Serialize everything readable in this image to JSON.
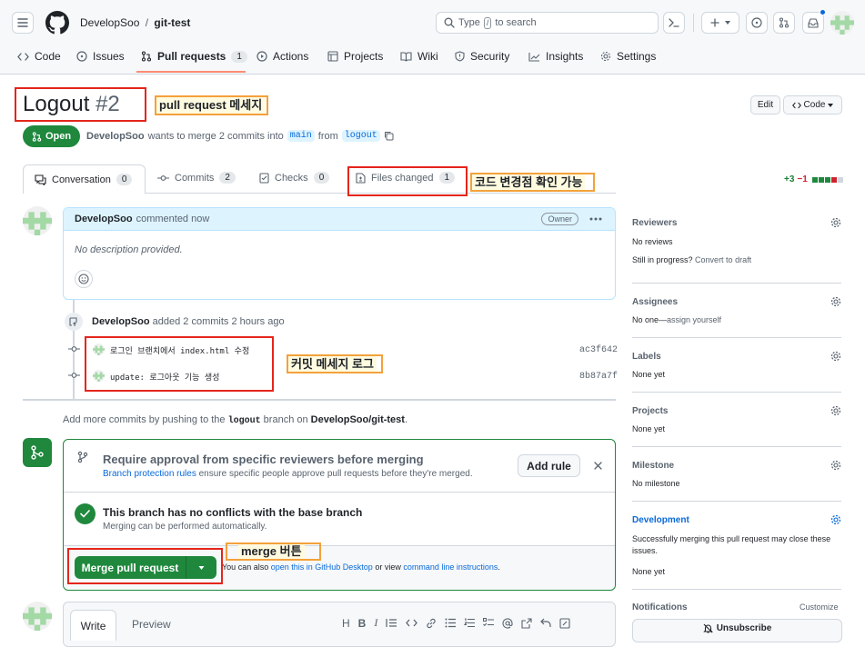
{
  "header": {
    "owner": "DevelopSoo",
    "sep": "/",
    "repo": "git-test",
    "search_prefix": "Type",
    "search_key": "/",
    "search_suffix": "to search"
  },
  "repo_nav": [
    {
      "label": "Code"
    },
    {
      "label": "Issues"
    },
    {
      "label": "Pull requests",
      "count": "1"
    },
    {
      "label": "Actions"
    },
    {
      "label": "Projects"
    },
    {
      "label": "Wiki"
    },
    {
      "label": "Security"
    },
    {
      "label": "Insights"
    },
    {
      "label": "Settings"
    }
  ],
  "pr": {
    "title": "Logout",
    "number": "#2",
    "state": "Open",
    "author": "DevelopSoo",
    "meta_text": "wants to merge 2 commits into",
    "base_branch": "main",
    "from_text": "from",
    "head_branch": "logout",
    "edit_label": "Edit",
    "code_label": "Code"
  },
  "pr_tabs": [
    {
      "label": "Conversation",
      "count": "0"
    },
    {
      "label": "Commits",
      "count": "2"
    },
    {
      "label": "Checks",
      "count": "0"
    },
    {
      "label": "Files changed",
      "count": "1"
    }
  ],
  "diffstat": {
    "add": "+3",
    "del": "−1"
  },
  "annotations": {
    "pr_message": "pull request 메세지",
    "files_changed": "코드 변경점 확인 가능",
    "commit_log": "커밋 메세지 로그",
    "merge_button": "merge 버튼"
  },
  "comment": {
    "author": "DevelopSoo",
    "action": "commented now",
    "role": "Owner",
    "body": "No description provided."
  },
  "commits_event": {
    "author": "DevelopSoo",
    "text": "added 2 commits 2 hours ago"
  },
  "commits": [
    {
      "message": "로그인 브랜치에서 index.html 수정",
      "sha": "ac3f642"
    },
    {
      "message": "update: 로그아웃 기능 생성",
      "sha": "8b87a7f"
    }
  ],
  "push_hint": {
    "prefix": "Add more commits by pushing to the",
    "branch": "logout",
    "middle": "branch on",
    "repo": "DevelopSoo/git-test",
    "suffix": "."
  },
  "merge_box": {
    "rule_title": "Require approval from specific reviewers before merging",
    "rule_link": "Branch protection rules",
    "rule_desc": "ensure specific people approve pull requests before they're merged.",
    "add_rule": "Add rule",
    "status_title": "This branch has no conflicts with the base branch",
    "status_desc": "Merging can be performed automatically.",
    "merge_label": "Merge pull request",
    "also_prefix": "You can also",
    "desktop_link": "open this in GitHub Desktop",
    "or_view": "or view",
    "cli_link": "command line instructions",
    "also_suffix": "."
  },
  "composer": {
    "write": "Write",
    "preview": "Preview"
  },
  "sidebar": {
    "reviewers": {
      "title": "Reviewers",
      "line1": "No reviews",
      "line2_prefix": "Still in progress?",
      "line2_link": "Convert to draft"
    },
    "assignees": {
      "title": "Assignees",
      "prefix": "No one—",
      "link": "assign yourself"
    },
    "labels": {
      "title": "Labels",
      "value": "None yet"
    },
    "projects": {
      "title": "Projects",
      "value": "None yet"
    },
    "milestone": {
      "title": "Milestone",
      "value": "No milestone"
    },
    "development": {
      "title": "Development",
      "desc": "Successfully merging this pull request may close these issues.",
      "value": "None yet"
    },
    "notifications": {
      "title": "Notifications",
      "customize": "Customize",
      "unsubscribe": "Unsubscribe"
    }
  },
  "colors": {
    "green": "#1f883d",
    "blue": "#0969da",
    "red": "#e5251b",
    "orange": "#f3a13b"
  }
}
